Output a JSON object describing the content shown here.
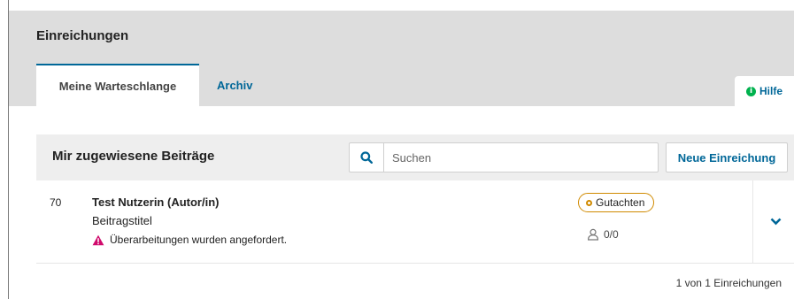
{
  "page": {
    "title": "Einreichungen"
  },
  "tabs": [
    {
      "label": "Meine Warteschlange",
      "active": true
    },
    {
      "label": "Archiv",
      "active": false
    }
  ],
  "help": {
    "label": "Hilfe",
    "icon": "info-icon"
  },
  "list": {
    "title": "Mir zugewiesene Beiträge",
    "search": {
      "placeholder": "Suchen",
      "value": "",
      "icon": "search-icon"
    },
    "new_submission_label": "Neue Einreichung",
    "items": [
      {
        "id": "70",
        "author": "Test Nutzerin (Autor/in)",
        "title": "Beitragstitel",
        "warning": "Überarbeitungen wurden angefordert.",
        "stage": "Gutachten",
        "reviewers": "0/0"
      }
    ],
    "pagination": "1 von 1 Einreichungen"
  },
  "colors": {
    "accent": "#006798",
    "help_icon": "#00b24e",
    "stage_border": "#d08a00",
    "warning": "#d00a6c",
    "header_band": "#dddddd"
  }
}
